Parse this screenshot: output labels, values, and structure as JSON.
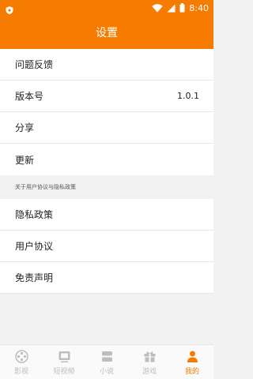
{
  "status_bar": {
    "time": "8:40",
    "icons": [
      "app-shield-icon",
      "wifi-icon",
      "cellular-signal-icon",
      "battery-icon"
    ]
  },
  "header": {
    "title": "设置"
  },
  "settings": {
    "items": [
      {
        "label": "问题反馈"
      },
      {
        "label": "版本号",
        "value": "1.0.1"
      },
      {
        "label": "分享"
      },
      {
        "label": "更新"
      }
    ],
    "section_title": "关于用户协议与隐私政策",
    "legal_items": [
      {
        "label": "隐私政策"
      },
      {
        "label": "用户协议"
      },
      {
        "label": "免责声明"
      }
    ]
  },
  "tab_bar": {
    "active_color": "#f57c00",
    "inactive_color": "#bdbdbd",
    "tabs": [
      {
        "label": "影视",
        "icon": "film-reel-icon",
        "active": false
      },
      {
        "label": "短视频",
        "icon": "video-screen-icon",
        "active": false
      },
      {
        "label": "小说",
        "icon": "book-icon",
        "active": false
      },
      {
        "label": "游戏",
        "icon": "gift-box-icon",
        "active": false
      },
      {
        "label": "我的",
        "icon": "user-icon",
        "active": true
      }
    ]
  }
}
